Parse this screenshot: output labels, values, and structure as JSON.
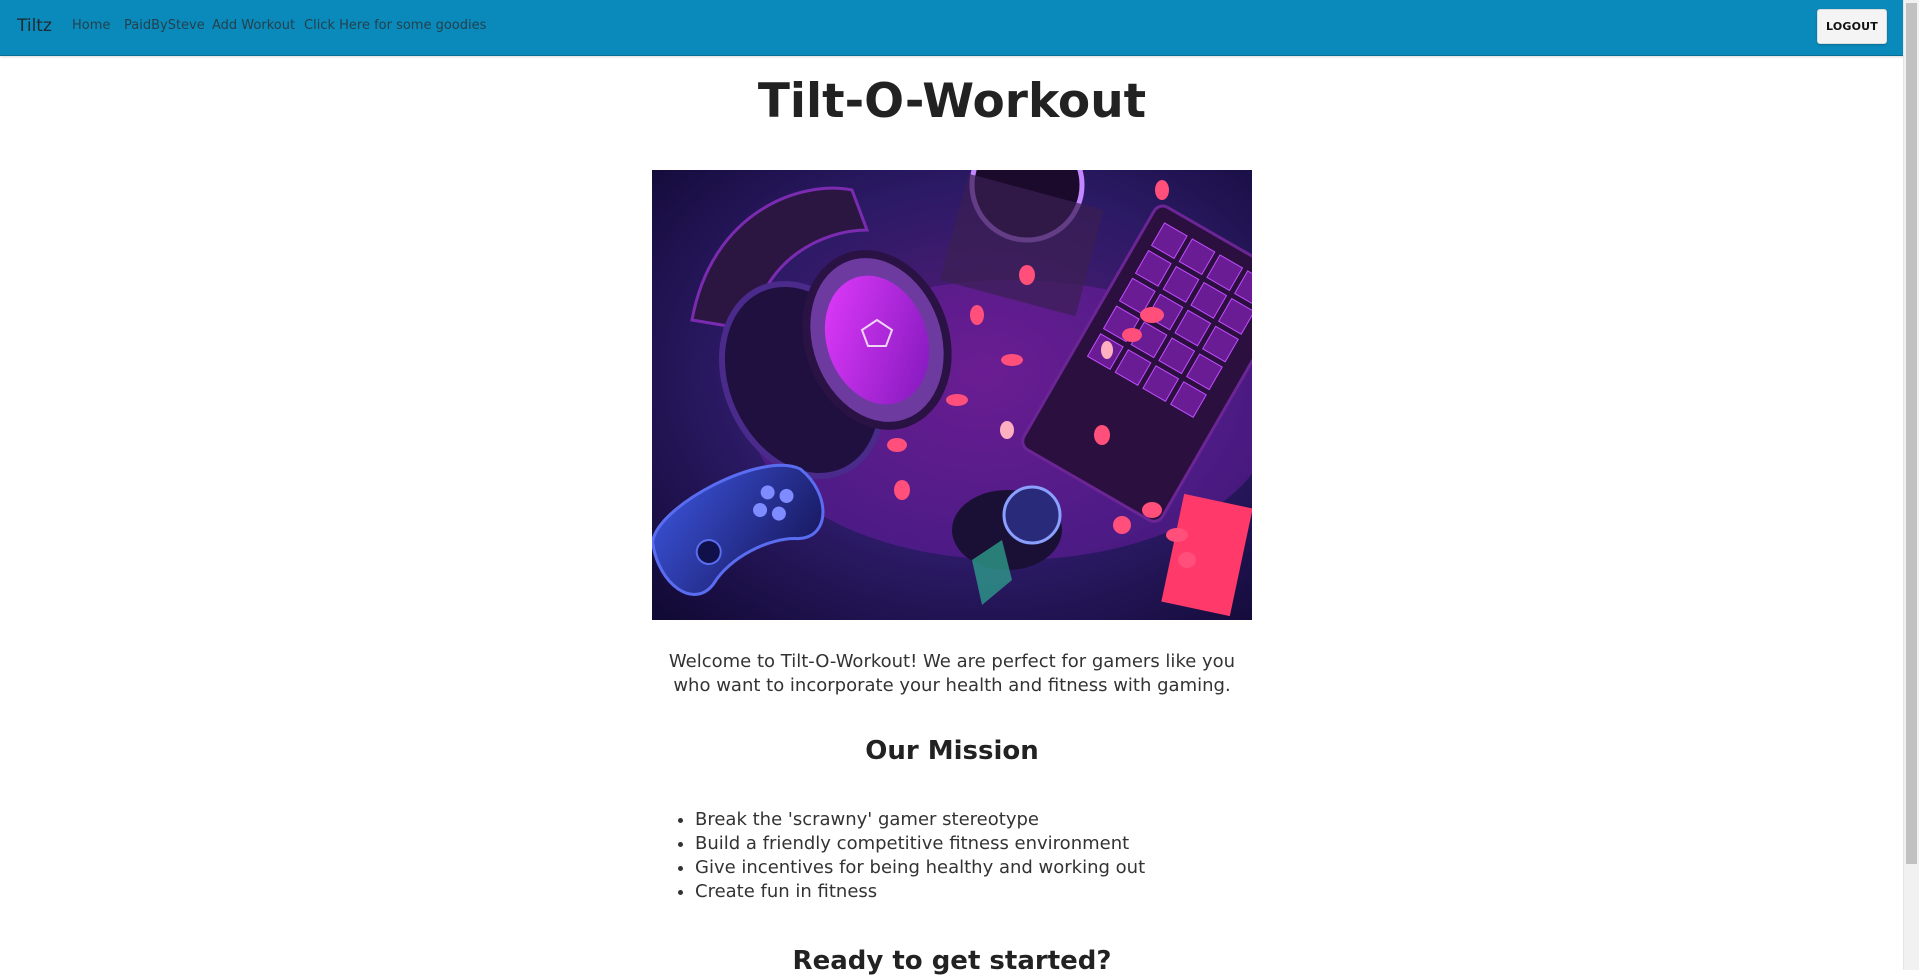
{
  "nav": {
    "brand": "Tiltz",
    "links": [
      "Home",
      "PaidBySteve",
      "Add Workout",
      "Click Here for some goodies"
    ],
    "logout_label": "LOGOUT"
  },
  "page": {
    "title": "Tilt-O-Workout",
    "welcome": "Welcome to Tilt-O-Workout! We are perfect for gamers like you who want to incorporate your health and fitness with gaming.",
    "mission_heading": "Our Mission",
    "mission_items": [
      "Break the 'scrawny' gamer stereotype",
      "Build a friendly competitive fitness environment",
      "Give incentives for being healthy and working out",
      "Create fun in fitness"
    ],
    "cta_heading": "Ready to get started?"
  },
  "colors": {
    "navbar": "#0a8abb",
    "accent_magenta": "#c21cff",
    "accent_blue": "#2b2aa6"
  }
}
